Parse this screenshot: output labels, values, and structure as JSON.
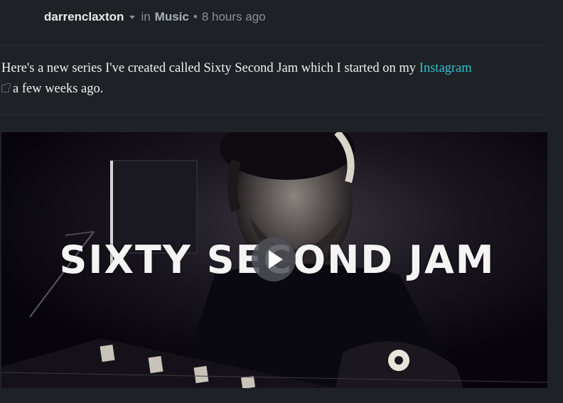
{
  "post": {
    "author": "darrenclaxton",
    "in_label": "in",
    "community": "Music",
    "separator": "•",
    "time": "8 hours ago",
    "body_part1": "Here's a new series I've created called Sixty Second Jam which I started on my ",
    "link_text": "Instagram",
    "body_part2": "a few weeks ago."
  },
  "video": {
    "overlay_title": "SIXTY SECOND JAM",
    "play_icon": "play-icon"
  },
  "colors": {
    "background": "#1e2226",
    "link": "#2fc2d1",
    "muted": "#8a9096"
  }
}
